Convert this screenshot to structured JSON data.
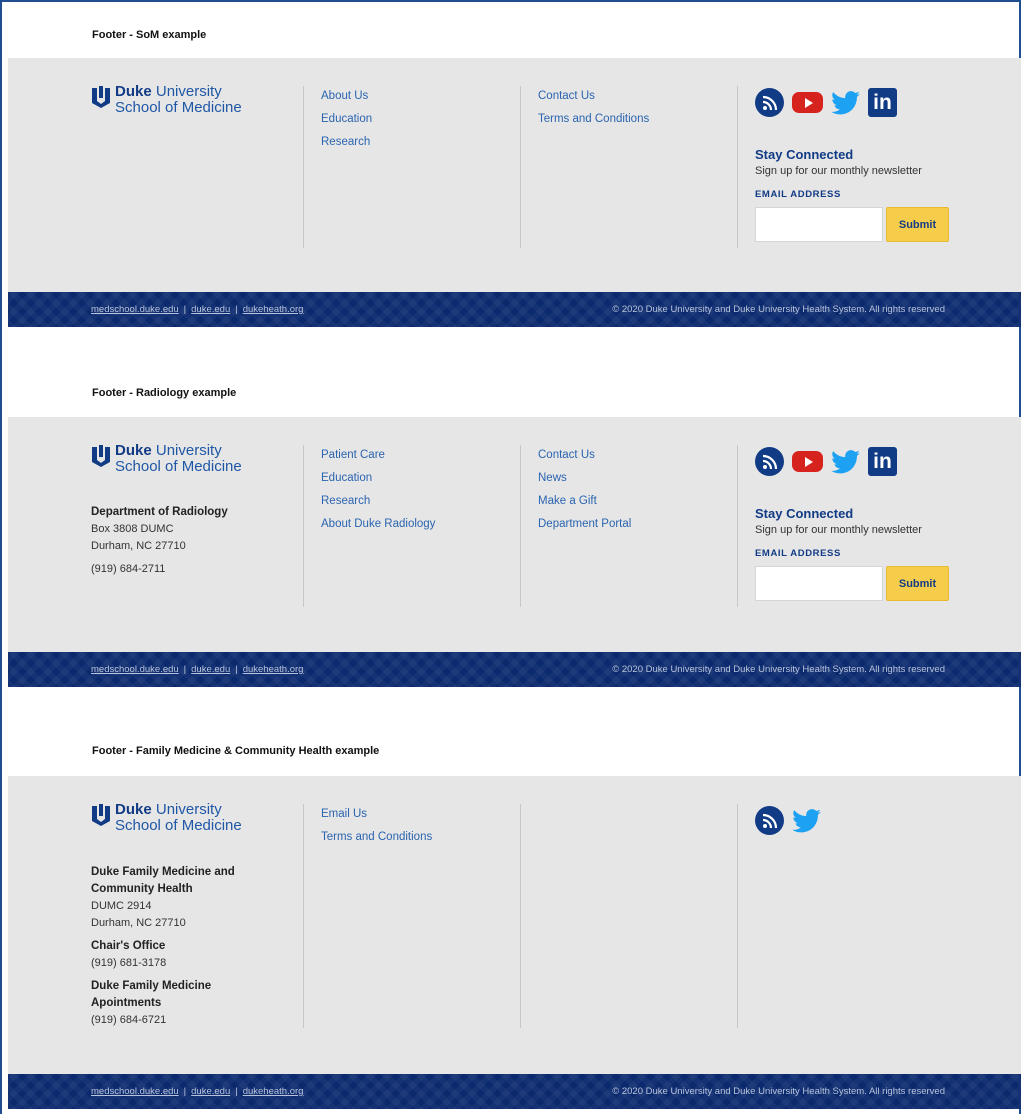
{
  "sections": [
    {
      "label": "Footer - SoM example",
      "logo": {
        "strong": "Duke",
        "line1": "University",
        "line2": "School of Medicine"
      },
      "col1_links": [
        "About Us",
        "Education",
        "Research"
      ],
      "col2_links": [
        "Contact Us",
        "Terms and Conditions"
      ],
      "social_icons": [
        "rss-icon",
        "youtube-icon",
        "twitter-icon",
        "linkedin-icon"
      ],
      "newsletter": {
        "title": "Stay Connected",
        "subtitle": "Sign up for our monthly newsletter",
        "label": "EMAIL ADDRESS",
        "placeholder": "",
        "submit": "Submit"
      }
    },
    {
      "label": "Footer - Radiology example",
      "logo": {
        "strong": "Duke",
        "line1": "University",
        "line2": "School of Medicine"
      },
      "address": {
        "name": "Department of Radiology",
        "line1": "Box 3808 DUMC",
        "line2": "Durham, NC 27710",
        "phone": "(919) 684-2711"
      },
      "col1_links": [
        "Patient Care",
        "Education",
        "Research",
        "About Duke Radiology"
      ],
      "col2_links": [
        "Contact Us",
        "News",
        "Make a Gift",
        "Department Portal"
      ],
      "social_icons": [
        "rss-icon",
        "youtube-icon",
        "twitter-icon",
        "linkedin-icon"
      ],
      "newsletter": {
        "title": "Stay Connected",
        "subtitle": "Sign up for our monthly newsletter",
        "label": "EMAIL ADDRESS",
        "placeholder": "",
        "submit": "Submit"
      }
    },
    {
      "label": "Footer - Family Medicine & Community Health example",
      "logo": {
        "strong": "Duke",
        "line1": "University",
        "line2": "School of Medicine"
      },
      "address": {
        "name1": "Duke Family Medicine and",
        "name2": "Community Health",
        "line1": "DUMC 2914",
        "line2": "Durham, NC 27710",
        "office_title": "Chair's Office",
        "office_phone": "(919) 681-3178",
        "appt_title1": "Duke Family Medicine",
        "appt_title2": "Apointments",
        "appt_phone": "(919) 684-6721"
      },
      "col1_links": [
        "Email Us",
        "Terms and Conditions"
      ],
      "social_icons": [
        "rss-icon",
        "twitter-icon"
      ]
    }
  ],
  "bottom_bar": {
    "links": [
      "medschool.duke.edu",
      "duke.edu",
      "dukeheath.org"
    ],
    "separator": "|",
    "copyright": "© 2020 Duke University and Duke University Health System. All rights reserved"
  },
  "colors": {
    "navy": "#123b86",
    "link_blue": "#2a64b0",
    "footer_gray": "#e6e6e6",
    "bar_navy": "#0b2a6e",
    "submit_yellow": "#f6cc4b",
    "youtube_red": "#d6231e",
    "twitter_blue": "#1da1f2"
  }
}
